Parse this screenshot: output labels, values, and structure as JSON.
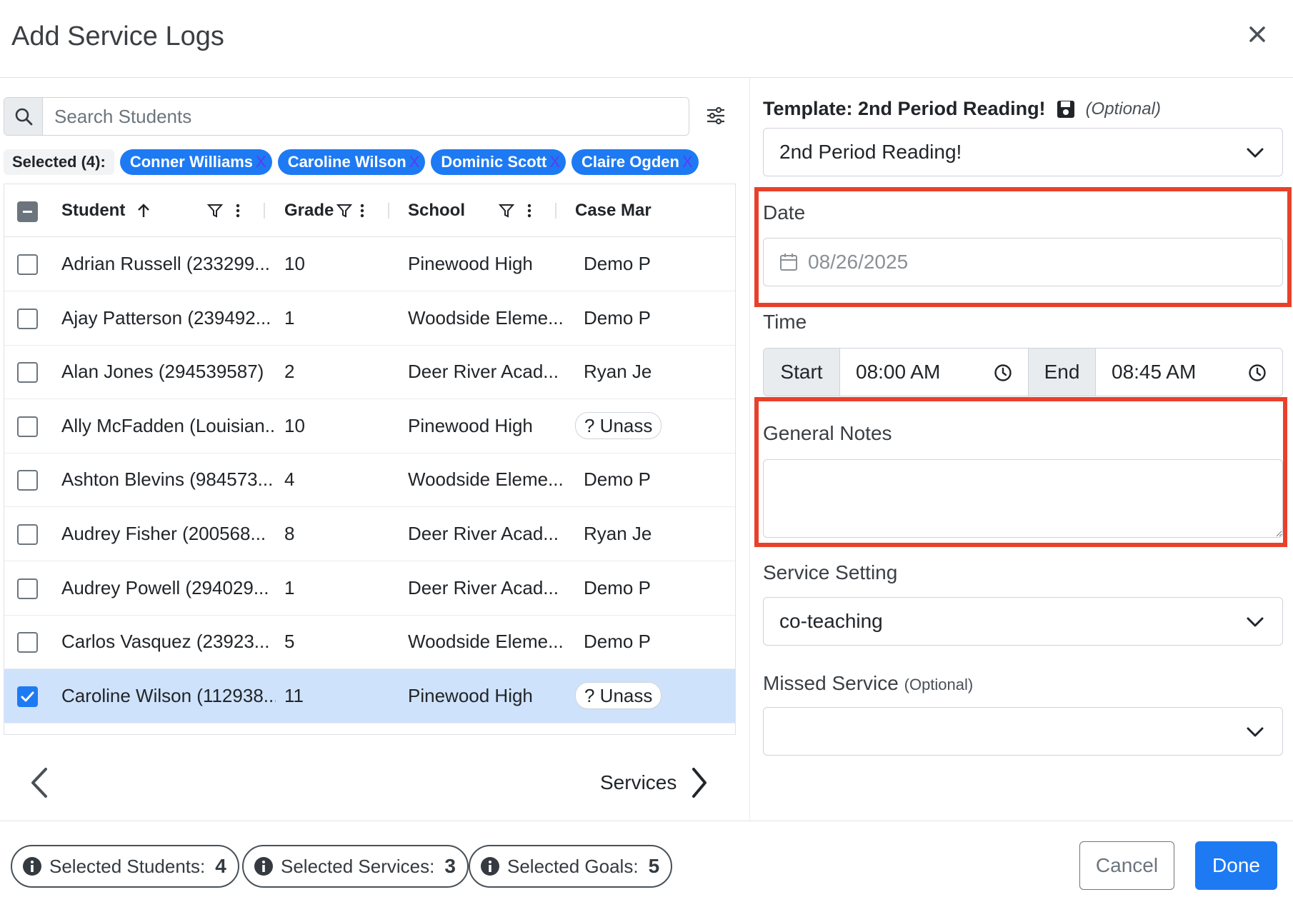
{
  "modal": {
    "title": "Add Service Logs"
  },
  "search": {
    "placeholder": "Search Students"
  },
  "selected": {
    "label": "Selected (4):",
    "chips": [
      "Conner Williams",
      "Caroline Wilson",
      "Dominic Scott",
      "Claire Ogden"
    ],
    "remove_glyph": "X"
  },
  "table": {
    "columns": [
      "Student",
      "Grade",
      "School",
      "Case Mar"
    ],
    "rows": [
      {
        "student": "Adrian Russell (233299...",
        "grade": "10",
        "school": "Pinewood High",
        "case": "Demo P",
        "checked": false
      },
      {
        "student": "Ajay Patterson (239492...",
        "grade": "1",
        "school": "Woodside Eleme...",
        "case": "Demo P",
        "checked": false
      },
      {
        "student": "Alan Jones (294539587)",
        "grade": "2",
        "school": "Deer River Acad...",
        "case": "Ryan Je",
        "checked": false
      },
      {
        "student": "Ally McFadden (Louisian...",
        "grade": "10",
        "school": "Pinewood High",
        "case": "? Unass",
        "checked": false
      },
      {
        "student": "Ashton Blevins (984573...",
        "grade": "4",
        "school": "Woodside Eleme...",
        "case": "Demo P",
        "checked": false
      },
      {
        "student": "Audrey Fisher (200568...",
        "grade": "8",
        "school": "Deer River Acad...",
        "case": "Ryan Je",
        "checked": false
      },
      {
        "student": "Audrey Powell (294029...",
        "grade": "1",
        "school": "Deer River Acad...",
        "case": "Demo P",
        "checked": false
      },
      {
        "student": "Carlos Vasquez (23923...",
        "grade": "5",
        "school": "Woodside Eleme...",
        "case": "Demo P",
        "checked": false
      },
      {
        "student": "Caroline Wilson (112938...",
        "grade": "11",
        "school": "Pinewood High",
        "case": "? Unass",
        "checked": true
      }
    ]
  },
  "nav": {
    "next_label": "Services"
  },
  "form": {
    "template_label": "Template: 2nd Period Reading!",
    "template_optional": "(Optional)",
    "template_value": "2nd Period Reading!",
    "date_label": "Date",
    "date_value": "08/26/2025",
    "time_label": "Time",
    "start_label": "Start",
    "start_value": "08:00 AM",
    "end_label": "End",
    "end_value": "08:45 AM",
    "notes_label": "General Notes",
    "notes_value": "",
    "setting_label": "Service Setting",
    "setting_value": "co-teaching",
    "missed_label": "Missed Service",
    "missed_optional": "(Optional)",
    "missed_value": ""
  },
  "footer": {
    "students_label": "Selected Students:",
    "students_count": "4",
    "services_label": "Selected Services:",
    "services_count": "3",
    "goals_label": "Selected Goals:",
    "goals_count": "5",
    "cancel_label": "Cancel",
    "done_label": "Done"
  },
  "colors": {
    "primary": "#1d7af3",
    "highlight": "#e8412b",
    "selected_row": "#cfe2fb"
  }
}
